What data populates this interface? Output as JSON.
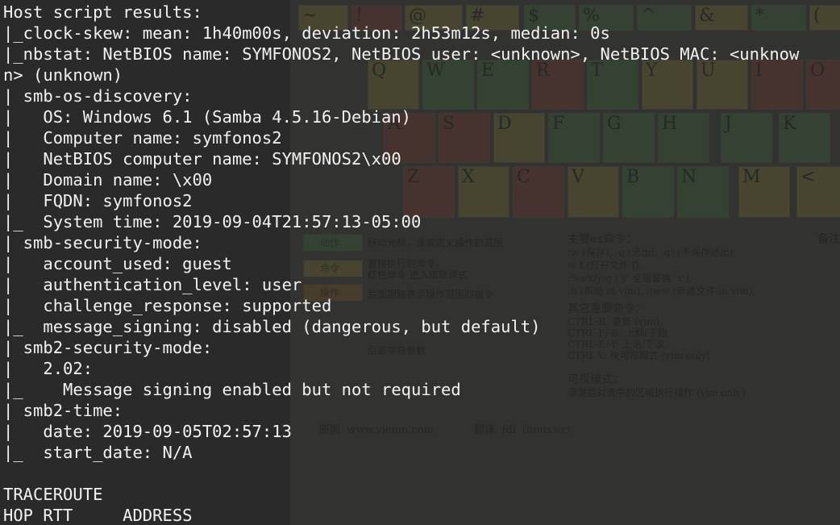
{
  "terminal": {
    "lines": [
      "Host script results:",
      "|_clock-skew: mean: 1h40m00s, deviation: 2h53m12s, median: 0s",
      "|_nbstat: NetBIOS name: SYMFONOS2, NetBIOS user: <unknown>, NetBIOS MAC: <unknow",
      "n> (unknown)",
      "| smb-os-discovery:",
      "|   OS: Windows 6.1 (Samba 4.5.16-Debian)",
      "|   Computer name: symfonos2",
      "|   NetBIOS computer name: SYMFONOS2\\x00",
      "|   Domain name: \\x00",
      "|   FQDN: symfonos2",
      "|_  System time: 2019-09-04T21:57:13-05:00",
      "| smb-security-mode:",
      "|   account_used: guest",
      "|   authentication_level: user",
      "|   challenge_response: supported",
      "|_  message_signing: disabled (dangerous, but default)",
      "| smb2-security-mode:",
      "|   2.02:",
      "|_    Message signing enabled but not required",
      "| smb2-time:",
      "|   date: 2019-09-05T02:57:13",
      "|_  start_date: N/A",
      "",
      "TRACEROUTE",
      "HOP RTT     ADDRESS"
    ]
  },
  "wallpaper": {
    "keys_row1": [
      "~",
      "!",
      "@",
      "#",
      "$",
      "%",
      "^",
      "&",
      "*",
      "("
    ],
    "keys_row2": [
      "Q",
      "W",
      "E",
      "R",
      "T",
      "Y",
      "U",
      "I",
      "O"
    ],
    "keys_row3": [
      "A",
      "S",
      "D",
      "F",
      "G",
      "H",
      "J",
      "K"
    ],
    "keys_row4": [
      "Z",
      "X",
      "C",
      "V",
      "B",
      "N",
      "M",
      "<"
    ],
    "text_commands_title": "主要ex命令：",
    "text_save_quit": ":w (保存), :q (退出), :q! (不保存退出)",
    "text_edit_file": ":e f (打开文件 f),",
    "text_replace": ":%s/x/y/g ('y' 全局替换 'x'),",
    "text_help": ":h (帮助 in vim), :new (新建文件 in vim),",
    "text_other_title": "其它重要命令：",
    "text_ctrl_r": "CTRL-R: 重复 (vim),",
    "text_ctrl_f": "CTRL-F/-B: 上翻/下翻,",
    "text_ctrl_e": "CTRL-E/-Y: 上滚/下滚,",
    "text_ctrl_v": "CTRL-V: 块可视模式 (vim only)",
    "text_visual_title": "可视模式：",
    "text_visual_desc": "漫游后对选中的区域执行操作 (vim only)",
    "text_legend_motion": "移动光标，或者定义操作的范围",
    "text_legend_command": "直接执行的命令，",
    "text_legend_insert": "红色命令 进入编辑模式",
    "text_legend_op": "后面跟随表示操作范围的指令",
    "text_legend_q": "后跟字符参数",
    "text_source": "原图: www.viemu.com",
    "text_translator": "翻译: fdl（linuxsir）",
    "text_notes": "备注",
    "swatch_motion": "动作",
    "swatch_command": "命令",
    "swatch_operator": "操作",
    "colors": {
      "motion": "#3f6a3a",
      "command": "#7a7333",
      "operator": "#7a5a2a"
    }
  }
}
